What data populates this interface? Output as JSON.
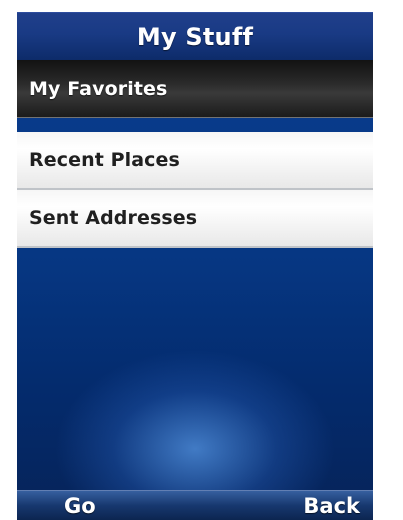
{
  "header": {
    "title": "My Stuff"
  },
  "menu": {
    "items": [
      {
        "label": "My Favorites",
        "selected": true
      },
      {
        "label": "Recent Places",
        "selected": false
      },
      {
        "label": "Sent Addresses",
        "selected": false
      }
    ]
  },
  "softkeys": {
    "left": "Go",
    "right": "Back"
  },
  "colors": {
    "screen_background": "#063783",
    "title_bar": "#193a84",
    "selected_item": "#2b2b2b",
    "menu_item": "#ffffff",
    "softkey_bar": "#17386f",
    "text_light": "#ffffff",
    "text_dark": "#202020"
  }
}
